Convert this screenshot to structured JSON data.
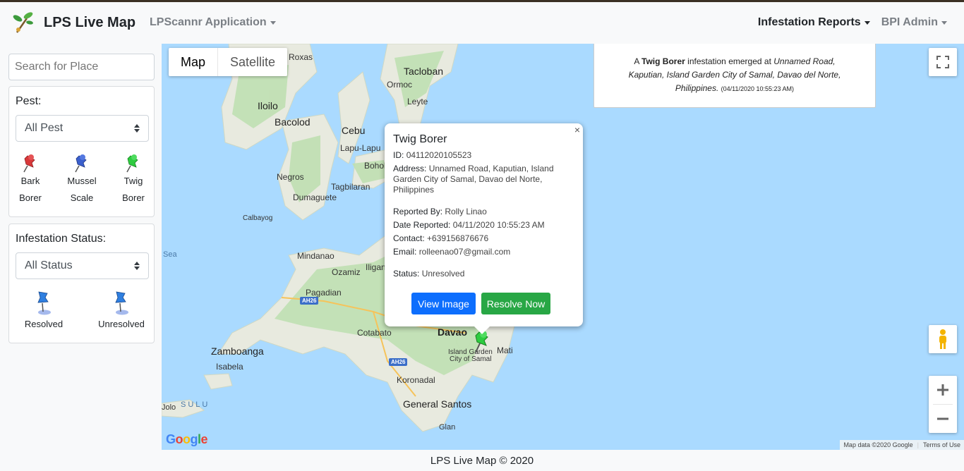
{
  "navbar": {
    "brand": "LPS Live Map",
    "app_menu": "LPScannr Application",
    "reports_menu": "Infestation Reports",
    "user_menu": "BPI Admin"
  },
  "sidebar": {
    "search_placeholder": "Search for Place",
    "pest_label": "Pest:",
    "pest_select": "All Pest",
    "pest_legend": [
      {
        "line1": "Bark",
        "line2": "Borer",
        "color": "#d9383a"
      },
      {
        "line1": "Mussel",
        "line2": "Scale",
        "color": "#3a5fcd"
      },
      {
        "line1": "Twig",
        "line2": "Borer",
        "color": "#2ecc40"
      }
    ],
    "status_label": "Infestation Status:",
    "status_select": "All Status",
    "status_legend": [
      {
        "label": "Resolved",
        "color": "#2f7fe0"
      },
      {
        "label": "Unresolved",
        "color": "#2f7fe0"
      }
    ]
  },
  "map": {
    "type_map": "Map",
    "type_satellite": "Satellite",
    "labels": {
      "roxas": "Roxas",
      "tacloban": "Tacloban",
      "ormoc": "Ormoc",
      "iloilo": "Iloilo",
      "bacolod": "Bacolod",
      "cebu": "Cebu",
      "lapu": "Lapu-Lapu",
      "leyte": "Leyte",
      "negros": "Negros",
      "bohol": "Bohol",
      "dumaguete": "Dumaguete",
      "tagbilaran": "Tagbilaran",
      "sea": "Sea",
      "mindanao": "Mindanao",
      "ozamiz": "Ozamiz",
      "iligan": "Iligan",
      "pagadian": "Pagadian",
      "cotabato": "Cotabato",
      "davao": "Davao",
      "mati": "Mati",
      "island_garden_1": "Island Garden",
      "island_garden_2": "City of Samal",
      "zamboanga": "Zamboanga",
      "isabela": "Isabela",
      "koronadal": "Koronadal",
      "general_santos": "General Santos",
      "glan": "Glan",
      "jolo": "Jolo",
      "sulu": "SULU",
      "calbayog": "Calbayog"
    },
    "highway_1": "AH26",
    "highway_2": "AH26",
    "google": "Google",
    "attribution": "Map data ©2020 Google",
    "terms": "Terms of Use"
  },
  "report_box": {
    "prefix": "A",
    "pest": "Twig Borer",
    "middle": "infestation emerged at",
    "address": "Unnamed Road, Kaputian, Island Garden City of Samal, Davao del Norte, Philippines.",
    "timestamp": "(04/11/2020 10:55:23 AM)"
  },
  "infowindow": {
    "title": "Twig Borer",
    "id_label": "ID:",
    "id_value": "04112020105523",
    "address_label": "Address:",
    "address_value": "Unnamed Road, Kaputian, Island Garden City of Samal, Davao del Norte, Philippines",
    "reported_by_label": "Reported By:",
    "reported_by_value": "Rolly Linao",
    "date_label": "Date Reported:",
    "date_value": "04/11/2020 10:55:23 AM",
    "contact_label": "Contact:",
    "contact_value": "+639156876676",
    "email_label": "Email:",
    "email_value": "rolleenao07@gmail.com",
    "status_label": "Status:",
    "status_value": "Unresolved",
    "close": "×",
    "view_image": "View Image",
    "resolve_now": "Resolve Now"
  },
  "footer": "LPS Live Map © 2020"
}
